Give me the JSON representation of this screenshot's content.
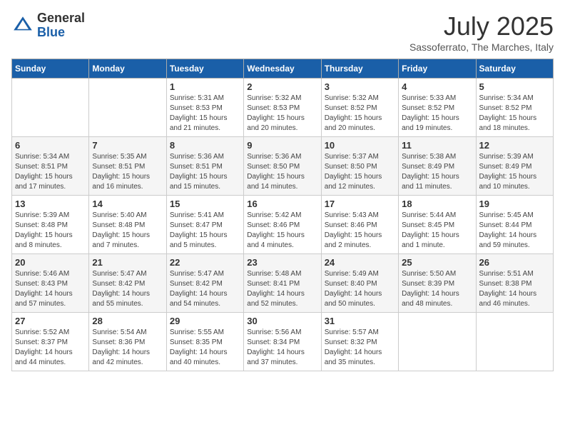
{
  "header": {
    "logo": {
      "line1": "General",
      "line2": "Blue"
    },
    "title": "July 2025",
    "subtitle": "Sassoferrato, The Marches, Italy"
  },
  "calendar": {
    "days_of_week": [
      "Sunday",
      "Monday",
      "Tuesday",
      "Wednesday",
      "Thursday",
      "Friday",
      "Saturday"
    ],
    "weeks": [
      [
        {
          "day": "",
          "info": ""
        },
        {
          "day": "",
          "info": ""
        },
        {
          "day": "1",
          "info": "Sunrise: 5:31 AM\nSunset: 8:53 PM\nDaylight: 15 hours and 21 minutes."
        },
        {
          "day": "2",
          "info": "Sunrise: 5:32 AM\nSunset: 8:53 PM\nDaylight: 15 hours and 20 minutes."
        },
        {
          "day": "3",
          "info": "Sunrise: 5:32 AM\nSunset: 8:52 PM\nDaylight: 15 hours and 20 minutes."
        },
        {
          "day": "4",
          "info": "Sunrise: 5:33 AM\nSunset: 8:52 PM\nDaylight: 15 hours and 19 minutes."
        },
        {
          "day": "5",
          "info": "Sunrise: 5:34 AM\nSunset: 8:52 PM\nDaylight: 15 hours and 18 minutes."
        }
      ],
      [
        {
          "day": "6",
          "info": "Sunrise: 5:34 AM\nSunset: 8:51 PM\nDaylight: 15 hours and 17 minutes."
        },
        {
          "day": "7",
          "info": "Sunrise: 5:35 AM\nSunset: 8:51 PM\nDaylight: 15 hours and 16 minutes."
        },
        {
          "day": "8",
          "info": "Sunrise: 5:36 AM\nSunset: 8:51 PM\nDaylight: 15 hours and 15 minutes."
        },
        {
          "day": "9",
          "info": "Sunrise: 5:36 AM\nSunset: 8:50 PM\nDaylight: 15 hours and 14 minutes."
        },
        {
          "day": "10",
          "info": "Sunrise: 5:37 AM\nSunset: 8:50 PM\nDaylight: 15 hours and 12 minutes."
        },
        {
          "day": "11",
          "info": "Sunrise: 5:38 AM\nSunset: 8:49 PM\nDaylight: 15 hours and 11 minutes."
        },
        {
          "day": "12",
          "info": "Sunrise: 5:39 AM\nSunset: 8:49 PM\nDaylight: 15 hours and 10 minutes."
        }
      ],
      [
        {
          "day": "13",
          "info": "Sunrise: 5:39 AM\nSunset: 8:48 PM\nDaylight: 15 hours and 8 minutes."
        },
        {
          "day": "14",
          "info": "Sunrise: 5:40 AM\nSunset: 8:48 PM\nDaylight: 15 hours and 7 minutes."
        },
        {
          "day": "15",
          "info": "Sunrise: 5:41 AM\nSunset: 8:47 PM\nDaylight: 15 hours and 5 minutes."
        },
        {
          "day": "16",
          "info": "Sunrise: 5:42 AM\nSunset: 8:46 PM\nDaylight: 15 hours and 4 minutes."
        },
        {
          "day": "17",
          "info": "Sunrise: 5:43 AM\nSunset: 8:46 PM\nDaylight: 15 hours and 2 minutes."
        },
        {
          "day": "18",
          "info": "Sunrise: 5:44 AM\nSunset: 8:45 PM\nDaylight: 15 hours and 1 minute."
        },
        {
          "day": "19",
          "info": "Sunrise: 5:45 AM\nSunset: 8:44 PM\nDaylight: 14 hours and 59 minutes."
        }
      ],
      [
        {
          "day": "20",
          "info": "Sunrise: 5:46 AM\nSunset: 8:43 PM\nDaylight: 14 hours and 57 minutes."
        },
        {
          "day": "21",
          "info": "Sunrise: 5:47 AM\nSunset: 8:42 PM\nDaylight: 14 hours and 55 minutes."
        },
        {
          "day": "22",
          "info": "Sunrise: 5:47 AM\nSunset: 8:42 PM\nDaylight: 14 hours and 54 minutes."
        },
        {
          "day": "23",
          "info": "Sunrise: 5:48 AM\nSunset: 8:41 PM\nDaylight: 14 hours and 52 minutes."
        },
        {
          "day": "24",
          "info": "Sunrise: 5:49 AM\nSunset: 8:40 PM\nDaylight: 14 hours and 50 minutes."
        },
        {
          "day": "25",
          "info": "Sunrise: 5:50 AM\nSunset: 8:39 PM\nDaylight: 14 hours and 48 minutes."
        },
        {
          "day": "26",
          "info": "Sunrise: 5:51 AM\nSunset: 8:38 PM\nDaylight: 14 hours and 46 minutes."
        }
      ],
      [
        {
          "day": "27",
          "info": "Sunrise: 5:52 AM\nSunset: 8:37 PM\nDaylight: 14 hours and 44 minutes."
        },
        {
          "day": "28",
          "info": "Sunrise: 5:54 AM\nSunset: 8:36 PM\nDaylight: 14 hours and 42 minutes."
        },
        {
          "day": "29",
          "info": "Sunrise: 5:55 AM\nSunset: 8:35 PM\nDaylight: 14 hours and 40 minutes."
        },
        {
          "day": "30",
          "info": "Sunrise: 5:56 AM\nSunset: 8:34 PM\nDaylight: 14 hours and 37 minutes."
        },
        {
          "day": "31",
          "info": "Sunrise: 5:57 AM\nSunset: 8:32 PM\nDaylight: 14 hours and 35 minutes."
        },
        {
          "day": "",
          "info": ""
        },
        {
          "day": "",
          "info": ""
        }
      ]
    ]
  }
}
